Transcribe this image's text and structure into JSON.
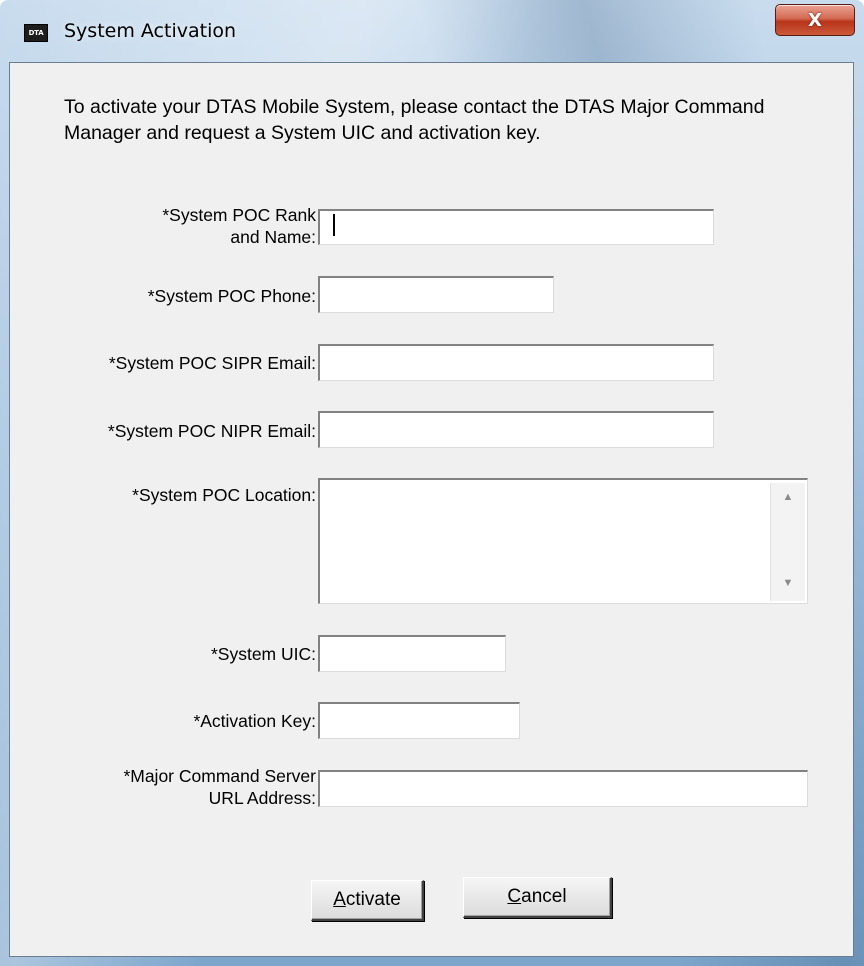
{
  "window": {
    "title": "System Activation",
    "icon_text": "DTA",
    "close_symbol": "X"
  },
  "instructions": "To activate your DTAS Mobile System, please contact the DTAS Major Command Manager and request a System UIC and activation key.",
  "form": {
    "rank_name_label_line1": "*System POC Rank",
    "rank_name_label_line2": "and Name:",
    "rank_name_value": "",
    "phone_label": "*System POC Phone:",
    "phone_value": "",
    "sipr_label": "*System POC SIPR Email:",
    "sipr_value": "",
    "nipr_label": "*System POC NIPR Email:",
    "nipr_value": "",
    "location_label": "*System POC Location:",
    "location_value": "",
    "uic_label": "*System UIC:",
    "uic_value": "",
    "key_label": "*Activation Key:",
    "key_value": "",
    "url_label_line1": "*Major Command Server",
    "url_label_line2": "URL Address:",
    "url_value": ""
  },
  "buttons": {
    "activate_mnemonic": "A",
    "activate_rest": "ctivate",
    "cancel_mnemonic": "C",
    "cancel_rest": "ancel"
  },
  "icons": {
    "scroll_up": "▲",
    "scroll_down": "▼"
  },
  "colors": {
    "close_button": "#c7472a",
    "dialog_background": "#f0f0f0"
  }
}
